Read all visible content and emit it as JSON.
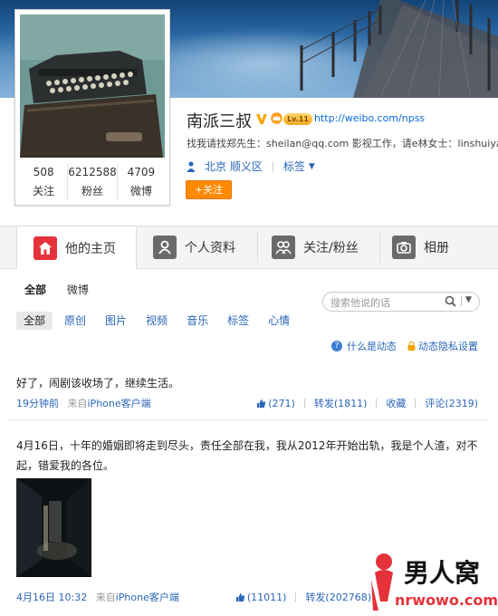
{
  "profile": {
    "name": "南派三叔",
    "level_badge": "Lv.11",
    "url": "http://weibo.com/npss",
    "description": "找我请找郑先生：sheilan@qq.com 影视工作，请e林女士：linshuiyao_",
    "location": "北京 顺义区",
    "tags_label": "标签",
    "follow_button": "+关注",
    "stats": [
      {
        "num": "508",
        "label": "关注"
      },
      {
        "num": "6212588",
        "label": "粉丝"
      },
      {
        "num": "4709",
        "label": "微博"
      }
    ]
  },
  "tabs": [
    {
      "label": "他的主页",
      "icon": "home-icon"
    },
    {
      "label": "个人资料",
      "icon": "person-icon"
    },
    {
      "label": "关注/粉丝",
      "icon": "people-icon"
    },
    {
      "label": "相册",
      "icon": "camera-icon"
    }
  ],
  "filters": {
    "primary": [
      "全部",
      "微博"
    ],
    "secondary": [
      "全部",
      "原创",
      "图片",
      "视频",
      "音乐",
      "标签",
      "心情"
    ],
    "search_placeholder": "搜索他说的话"
  },
  "help": {
    "what_is": "什么是动态",
    "privacy": "动态隐私设置"
  },
  "posts": [
    {
      "text": "好了，闹剧该收场了，继续生活。",
      "time": "19分钟前",
      "source_prefix": "来自",
      "source": "iPhone客户端",
      "likes": "(271)",
      "repost": "转发(1811)",
      "favorite": "收藏",
      "comment": "评论(2319)"
    },
    {
      "text": "4月16日，十年的婚姻即将走到尽头，责任全部在我，我从2012年开始出轨，我是个人渣，对不起，错爱我的各位。",
      "time": "4月16日  10:32",
      "source_prefix": "来自",
      "source": "iPhone客户端",
      "likes": "(11011)",
      "repost": "转发(202768)"
    }
  ],
  "watermark": {
    "title": "男人窝",
    "url": "nrwowo.com"
  },
  "colors": {
    "link": "#2a66b8",
    "follow": "#ff8a00",
    "home_icon": "#e5323a"
  }
}
